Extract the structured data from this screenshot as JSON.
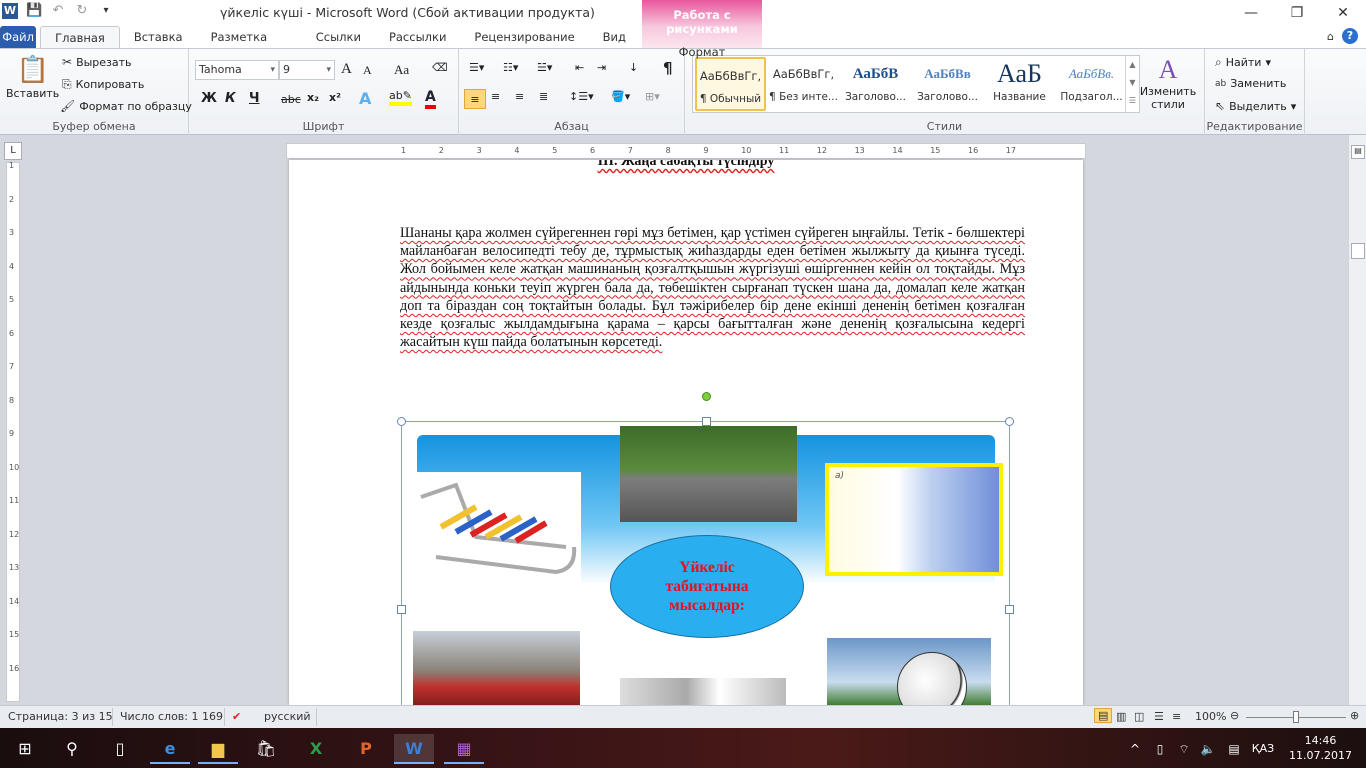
{
  "window": {
    "title": "үйкеліс күші  -  Microsoft Word (Сбой активации продукта)",
    "context_group": "Работа с рисунками",
    "context_tab": "Формат"
  },
  "qat": {
    "word_icon": "W",
    "save_icon": "save-icon",
    "undo_icon": "undo-icon",
    "redo_icon": "redo-icon",
    "customize_icon": "customize-icon"
  },
  "tabs": [
    "Файл",
    "Главная",
    "Вставка",
    "Разметка страницы",
    "Ссылки",
    "Рассылки",
    "Рецензирование",
    "Вид"
  ],
  "ribbon": {
    "clipboard": {
      "label": "Буфер обмена",
      "paste": "Вставить",
      "cut": "Вырезать",
      "copy": "Копировать",
      "format_painter": "Формат по образцу"
    },
    "font": {
      "label": "Шрифт",
      "font_name": "Tahoma",
      "font_size": "9",
      "bold": "Ж",
      "italic": "К",
      "underline": "Ч",
      "strike": "abc",
      "sub": "x₂",
      "sup": "x²",
      "grow": "A",
      "shrink": "A",
      "case": "Aa"
    },
    "paragraph": {
      "label": "Абзац",
      "pilcrow": "¶"
    },
    "styles": {
      "label": "Стили",
      "items": [
        {
          "preview": "АаБбВвГг,",
          "name": "¶ Обычный"
        },
        {
          "preview": "АаБбВвГг,",
          "name": "¶ Без инте..."
        },
        {
          "preview": "АаБбВ",
          "name": "Заголово..."
        },
        {
          "preview": "АаБбВв",
          "name": "Заголово..."
        },
        {
          "preview": "АаБ",
          "name": "Название"
        },
        {
          "preview": "АаБбВв.",
          "name": "Подзагол..."
        }
      ],
      "change_styles": "Изменить стили"
    },
    "editing": {
      "label": "Редактирование",
      "find": "Найти",
      "replace": "Заменить",
      "select": "Выделить"
    }
  },
  "document": {
    "heading": "ІІІ. Жаңа сабақты түсіндіру",
    "paragraph": "Шананы қара жолмен сүйрегеннен гөрі мұз бетімен, қар үстімен сүйреген ыңғайлы. Тетік - бөлшектері майланбаған велосипедті тебу де, тұрмыстық жиһаздарды еден бетімен жылжыту да қиынға түседі. Жол бойымен келе жатқан машинаның қозғалтқышын жүргізуші өшіргеннен кейін ол тоқтайды. Мұз айдынында коньки теуіп жүрген бала да, төбешіктен сырғанап түскен шана да, домалап келе жатқан доп та біраздан соң тоқтайтын болады. Бұл тәжірибелер бір дене екінші дененің бетімен қозғалған кезде қозғалыс жылдамдығына қарама – қарсы бағытталған және дененің қозғалысына кедергі жасайтын күш пайда болатынын көрсетеді.",
    "figure_center_text": "Үйкеліс табиғатына мысалдар:",
    "sofa_label": "а)"
  },
  "ruler": {
    "h_ticks": [
      "1",
      "2",
      "3",
      "4",
      "5",
      "6",
      "7",
      "8",
      "9",
      "10",
      "11",
      "12",
      "13",
      "14",
      "15",
      "16",
      "17"
    ],
    "v_ticks": [
      "1",
      "2",
      "3",
      "4",
      "5",
      "6",
      "7",
      "8",
      "9",
      "10",
      "11",
      "12",
      "13",
      "14",
      "15",
      "16"
    ]
  },
  "status": {
    "page": "Страница: 3 из 15",
    "words": "Число слов: 1 169",
    "language": "русский",
    "zoom": "100%",
    "zoom_percent": 100
  },
  "taskbar": {
    "time": "14:46",
    "date": "11.07.2017",
    "lang": "ҚАЗ"
  },
  "colors": {
    "file_tab": "#2b5cae",
    "context": "#e9559c",
    "ellipse": "#29aef0",
    "ellipse_text": "#e8101c"
  }
}
